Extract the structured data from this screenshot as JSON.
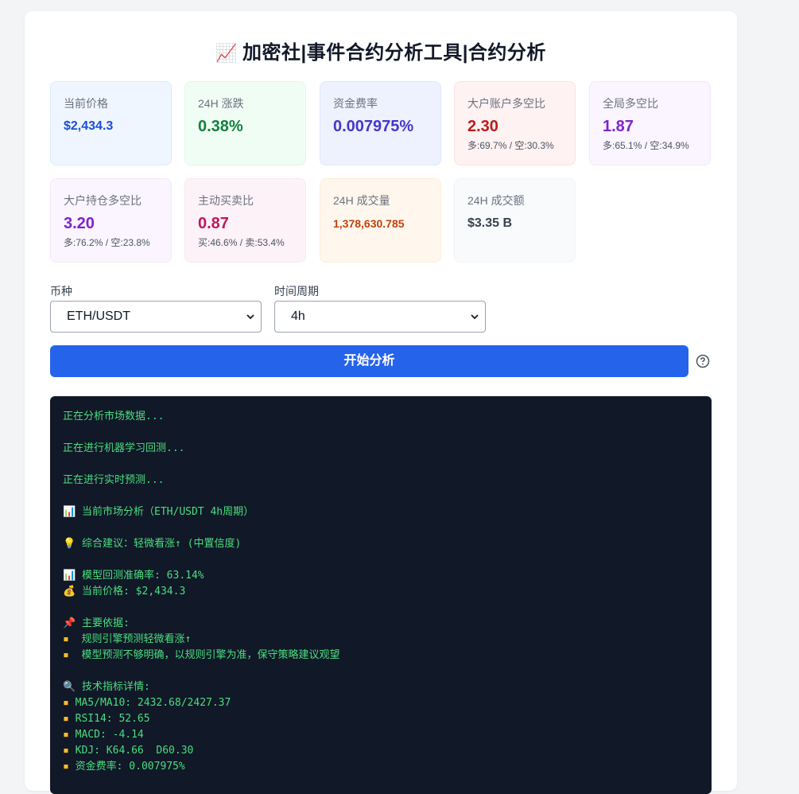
{
  "title": {
    "emoji": "📈",
    "text": "加密社|事件合约分析工具|合约分析"
  },
  "stats": [
    {
      "label": "当前价格",
      "value": "$2,434.3",
      "sub": "",
      "color": "#1d4ed8",
      "bg": "#eff6ff",
      "border": "#dbeafe"
    },
    {
      "label": "24H 涨跌",
      "value": "0.38%",
      "sub": "",
      "color": "#15803d",
      "bg": "#f0fdf4",
      "border": "#dcfce7"
    },
    {
      "label": "资金费率",
      "value": "0.007975%",
      "sub": "",
      "color": "#4338ca",
      "bg": "#eef2ff",
      "border": "#e0e7ff"
    },
    {
      "label": "大户账户多空比",
      "value": "2.30",
      "sub": "多:69.7% / 空:30.3%",
      "color": "#b91c1c",
      "bg": "#fef2f2",
      "border": "#fee2e2"
    },
    {
      "label": "全局多空比",
      "value": "1.87",
      "sub": "多:65.1% / 空:34.9%",
      "color": "#7e22ce",
      "bg": "#faf5ff",
      "border": "#f3e8ff"
    },
    {
      "label": "大户持仓多空比",
      "value": "3.20",
      "sub": "多:76.2% / 空:23.8%",
      "color": "#7e22ce",
      "bg": "#faf5ff",
      "border": "#f3e8ff"
    },
    {
      "label": "主动买卖比",
      "value": "0.87",
      "sub": "买:46.6% / 卖:53.4%",
      "color": "#be185d",
      "bg": "#fdf2f8",
      "border": "#fce7f3"
    },
    {
      "label": "24H 成交量",
      "value": "1,378,630.785",
      "sub": "",
      "color": "#c2410c",
      "bg": "#fff7ed",
      "border": "#ffedd5"
    },
    {
      "label": "24H 成交额",
      "value": "$3.35 B",
      "sub": "",
      "color": "#374151",
      "bg": "#f9fafb",
      "border": "#f3f4f6"
    }
  ],
  "form": {
    "coin_label": "币种",
    "coin_value": "ETH/USDT",
    "period_label": "时间周期",
    "period_value": "4h",
    "analyze_label": "开始分析"
  },
  "terminal": {
    "lines": [
      {
        "icon": "",
        "text": "正在分析市场数据..."
      },
      {
        "icon": "",
        "text": ""
      },
      {
        "icon": "",
        "text": "正在进行机器学习回测..."
      },
      {
        "icon": "",
        "text": ""
      },
      {
        "icon": "",
        "text": "正在进行实时预测..."
      },
      {
        "icon": "",
        "text": ""
      },
      {
        "icon": "📊",
        "text": " 当前市场分析（ETH/USDT 4h周期）"
      },
      {
        "icon": "",
        "text": ""
      },
      {
        "icon": "💡",
        "text": " 综合建议：轻微看涨↑ (中置信度)"
      },
      {
        "icon": "",
        "text": ""
      },
      {
        "icon": "📊",
        "text": " 模型回测准确率: 63.14%"
      },
      {
        "icon": "💰",
        "text": " 当前价格: $2,434.3"
      },
      {
        "icon": "",
        "text": ""
      },
      {
        "icon": "📌",
        "text": " 主要依据:"
      },
      {
        "icon": "▪",
        "text": "  规则引擎预测轻微看涨↑"
      },
      {
        "icon": "▪",
        "text": "  模型预测不够明确，以规则引擎为准，保守策略建议观望"
      },
      {
        "icon": "",
        "text": ""
      },
      {
        "icon": "🔍",
        "text": " 技术指标详情:"
      },
      {
        "icon": "▪",
        "text": " MA5/MA10: 2432.68/2427.37"
      },
      {
        "icon": "▪",
        "text": " RSI14: 52.65"
      },
      {
        "icon": "▪",
        "text": " MACD: -4.14"
      },
      {
        "icon": "▪",
        "text": " KDJ: K64.66  D60.30"
      },
      {
        "icon": "▪",
        "text": " 资金费率: 0.007975%"
      }
    ]
  },
  "icons": {
    "help": "help-circle-icon",
    "chevron": "chevron-down-icon"
  }
}
